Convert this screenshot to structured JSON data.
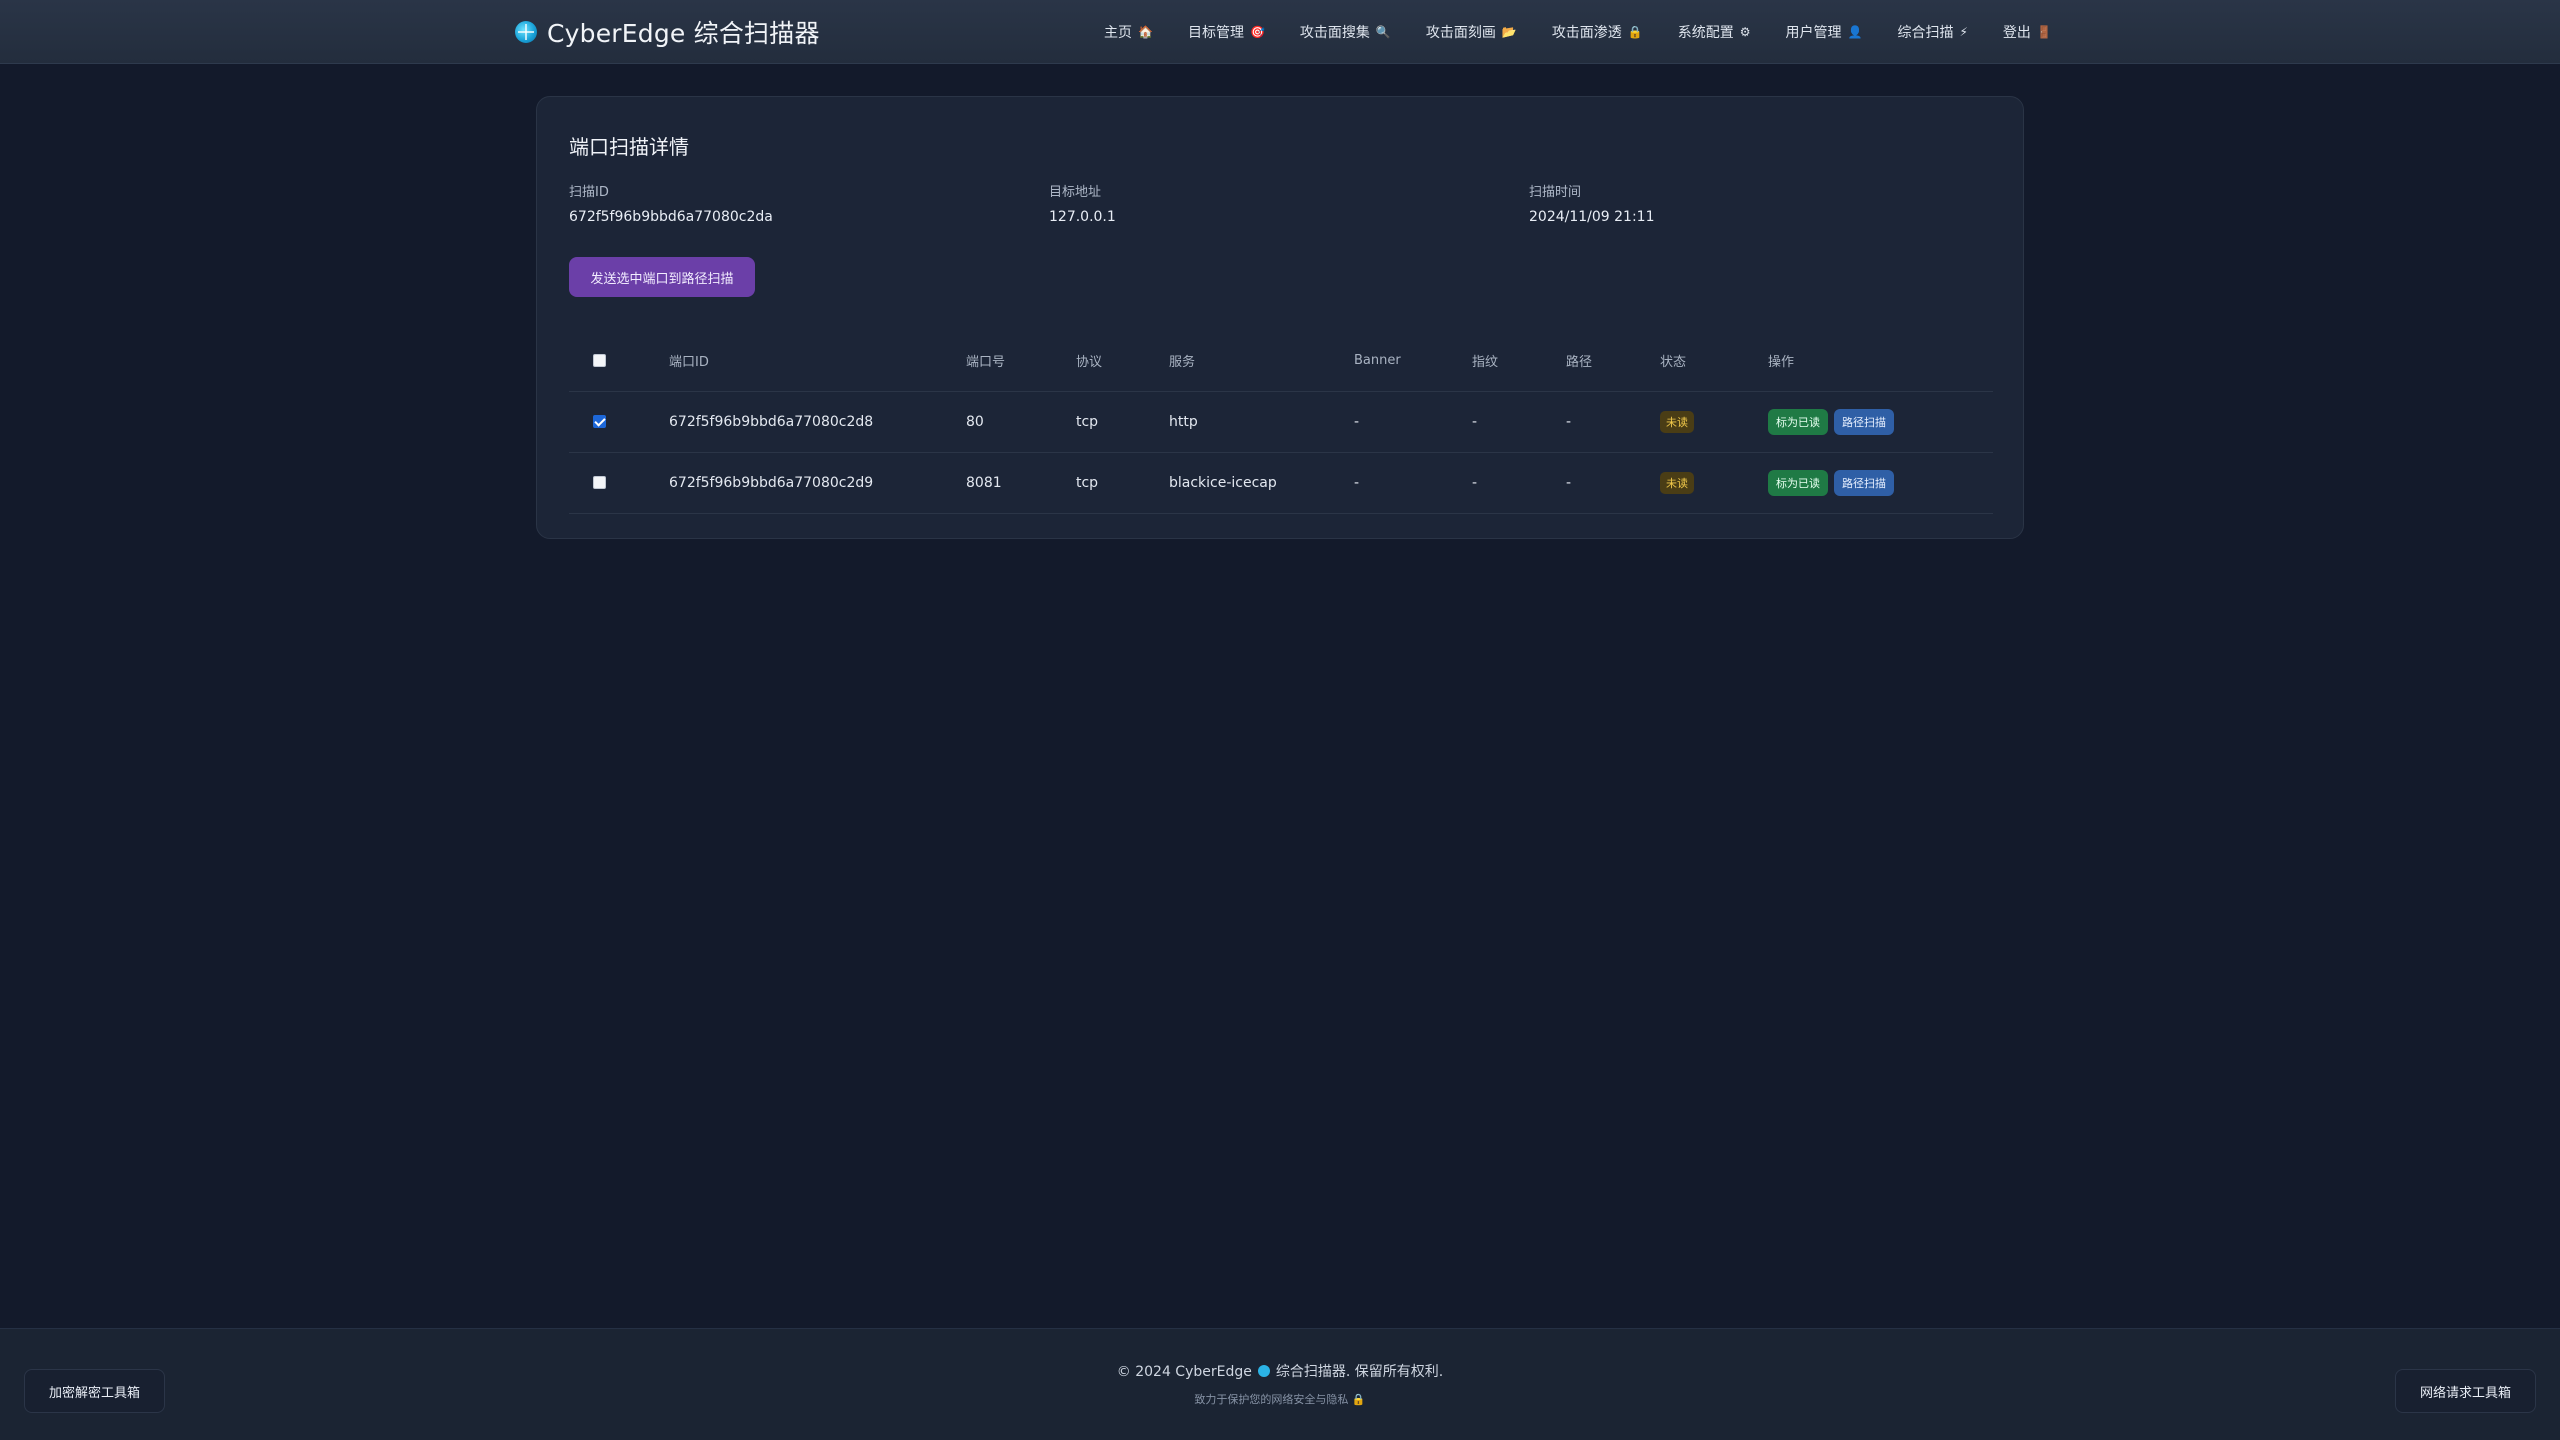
{
  "app": {
    "title": "CyberEdge 综合扫描器"
  },
  "nav": [
    {
      "label": "主页",
      "icon": "🏠"
    },
    {
      "label": "目标管理",
      "icon": "🎯"
    },
    {
      "label": "攻击面搜集",
      "icon": "🔍"
    },
    {
      "label": "攻击面刻画",
      "icon": "📂"
    },
    {
      "label": "攻击面渗透",
      "icon": "🔒"
    },
    {
      "label": "系统配置",
      "icon": "⚙"
    },
    {
      "label": "用户管理",
      "icon": "👤"
    },
    {
      "label": "综合扫描",
      "icon": "⚡"
    },
    {
      "label": "登出",
      "icon": "🚪"
    }
  ],
  "card": {
    "title": "端口扫描详情",
    "scan_id_label": "扫描ID",
    "scan_id": "672f5f96b9bbd6a77080c2da",
    "target_label": "目标地址",
    "target": "127.0.0.1",
    "time_label": "扫描时间",
    "time": "2024/11/09 21:11",
    "send_button": "发送选中端口到路径扫描"
  },
  "table": {
    "headers": {
      "port_id": "端口ID",
      "port": "端口号",
      "protocol": "协议",
      "service": "服务",
      "banner": "Banner",
      "fingerprint": "指纹",
      "path": "路径",
      "status": "状态",
      "actions": "操作"
    },
    "rows": [
      {
        "checked": true,
        "port_id": "672f5f96b9bbd6a77080c2d8",
        "port": "80",
        "protocol": "tcp",
        "service": "http",
        "banner": "-",
        "fingerprint": "-",
        "path": "-",
        "status": "未读",
        "mark_read": "标为已读",
        "path_scan": "路径扫描"
      },
      {
        "checked": false,
        "port_id": "672f5f96b9bbd6a77080c2d9",
        "port": "8081",
        "protocol": "tcp",
        "service": "blackice-icecap",
        "banner": "-",
        "fingerprint": "-",
        "path": "-",
        "status": "未读",
        "mark_read": "标为已读",
        "path_scan": "路径扫描"
      }
    ]
  },
  "footer": {
    "copyright_pre": "© 2024 CyberEdge",
    "copyright_post": "综合扫描器. 保留所有权利.",
    "tagline": "致力于保护您的网络安全与隐私",
    "tagline_icon": "🔒",
    "left_tool": "加密解密工具箱",
    "right_tool": "网络请求工具箱"
  }
}
